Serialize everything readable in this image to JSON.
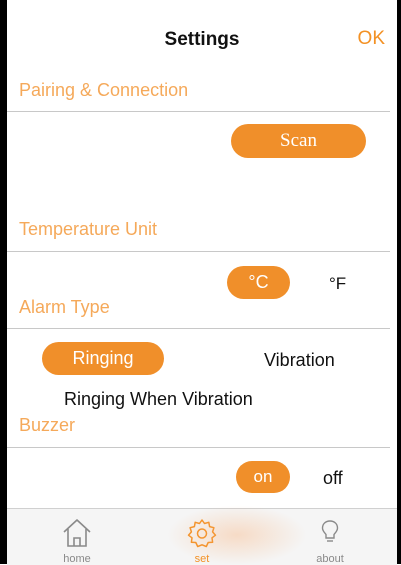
{
  "header": {
    "title": "Settings",
    "ok_label": "OK"
  },
  "sections": {
    "pairing": {
      "title": "Pairing & Connection",
      "scan_label": "Scan"
    },
    "temperature": {
      "title": "Temperature Unit",
      "celsius_label": "°C",
      "fahrenheit_label": "°F",
      "selected": "°C"
    },
    "alarm": {
      "title": "Alarm Type",
      "ringing_label": "Ringing",
      "vibration_label": "Vibration",
      "ringing_vibration_label": "Ringing When Vibration",
      "selected": "Ringing"
    },
    "buzzer": {
      "title": "Buzzer",
      "on_label": "on",
      "off_label": "off",
      "selected": "on"
    }
  },
  "tabbar": {
    "items": [
      {
        "label": "home",
        "icon": "home-icon",
        "active": false
      },
      {
        "label": "set",
        "icon": "gear-icon",
        "active": true
      },
      {
        "label": "about",
        "icon": "lightbulb-icon",
        "active": false
      }
    ]
  },
  "colors": {
    "accent": "#f08f2a",
    "section_title": "#f5a95a",
    "divider": "#c8c8c8"
  }
}
